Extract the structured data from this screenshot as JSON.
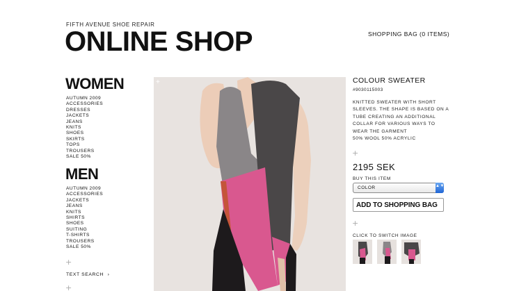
{
  "header": {
    "subtitle": "FIFTH AVENUE SHOE REPAIR",
    "title": "ONLINE SHOP",
    "shopping_bag": "SHOPPING BAG (0 ITEMS)"
  },
  "sidebar": {
    "women": {
      "heading": "WOMEN",
      "items": [
        "AUTUMN 2009",
        "ACCESSORIES",
        "DRESSES",
        "JACKETS",
        "JEANS",
        "KNITS",
        "SHOES",
        "SKIRTS",
        "TOPS",
        "TROUSERS",
        "SALE 50%"
      ]
    },
    "men": {
      "heading": "MEN",
      "items": [
        "AUTUMN 2009",
        "ACCESSORIES",
        "JACKETS",
        "JEANS",
        "KNITS",
        "SHIRTS",
        "SHOES",
        "SUITING",
        "T-SHIRTS",
        "TROUSERS",
        "SALE 50%"
      ]
    },
    "text_search": "TEXT SEARCH",
    "text_search_arrow": "›"
  },
  "product": {
    "title": "COLOUR SWEATER",
    "sku": "#9030115003",
    "description": "KNITTED SWEATER WITH SHORT SLEEVES. THE SHAPE IS BASED ON A TUBE CREATING AN ADDITIONAL COLLAR FOR VARIOUS WAYS TO WEAR THE GARMENT",
    "material": "50% WOOL 50% ACRYLIC",
    "price": "2195 SEK",
    "buy_label": "BUY THIS ITEM",
    "color_select_value": "COLOR",
    "add_to_bag": "ADD TO SHOPPING BAG",
    "switch_image_label": "CLICK TO SWITCH IMAGE"
  },
  "glyphs": {
    "plus": "+",
    "select_arrows": "▲▼"
  },
  "colors": {
    "pink": "#d9588f",
    "dark_knit": "#4a4748",
    "grey_knit": "#8a8688",
    "orange": "#c4553a",
    "select_blue": "#2f74de"
  }
}
